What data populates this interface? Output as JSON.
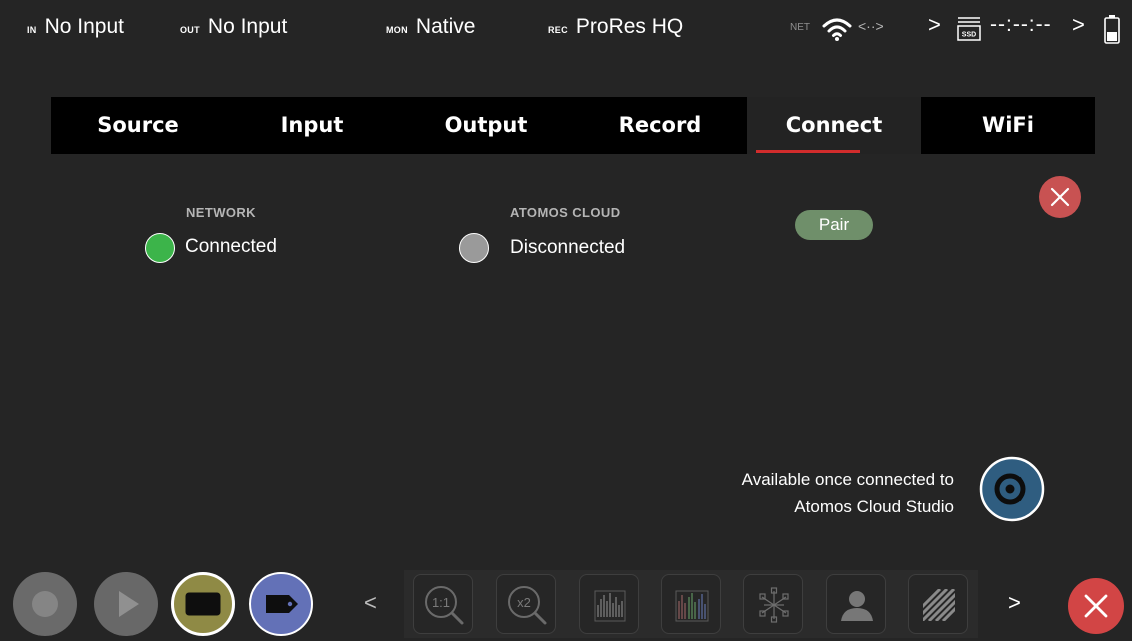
{
  "status_bar": {
    "input": {
      "tag": "IN",
      "value": "No Input"
    },
    "output": {
      "tag": "OUT",
      "value": "No Input"
    },
    "monitor": {
      "tag": "MON",
      "value": "Native"
    },
    "record": {
      "tag": "REC",
      "value": "ProRes HQ"
    },
    "network": {
      "tag": "NET",
      "wifi_icon": "wifi-icon",
      "link_icon": "network-arrows-icon",
      "link_glyph": "<··>"
    },
    "chevron_glyph": ">",
    "storage": {
      "icon": "ssd-icon",
      "label": "SSD",
      "timecode": "--:--:--"
    },
    "battery_icon": "battery-icon"
  },
  "tabs": [
    {
      "label": "Source",
      "active": false
    },
    {
      "label": "Input",
      "active": false
    },
    {
      "label": "Output",
      "active": false
    },
    {
      "label": "Record",
      "active": false
    },
    {
      "label": "Connect",
      "active": true
    },
    {
      "label": "WiFi",
      "active": false
    }
  ],
  "connect": {
    "network": {
      "title": "NETWORK",
      "status": "Connected",
      "status_color": "#3cb44a"
    },
    "cloud": {
      "title": "ATOMOS CLOUD",
      "status": "Disconnected",
      "status_color": "#9a9a9a"
    },
    "pair_button": "Pair",
    "close_icon": "close-icon",
    "cloud_message": {
      "line1": "Available once connected to",
      "line2": "Atomos Cloud Studio"
    },
    "cloud_studio_icon": "atomos-cloud-studio-icon"
  },
  "toolbar": {
    "buttons": [
      {
        "name": "record-button",
        "icon": "record-icon"
      },
      {
        "name": "play-button",
        "icon": "play-icon"
      },
      {
        "name": "monitor-mode-button",
        "icon": "monitor-icon"
      },
      {
        "name": "tag-button",
        "icon": "tag-icon"
      }
    ],
    "prev_glyph": "<",
    "next_glyph": ">",
    "tools": [
      {
        "name": "zoom-1-1-tool",
        "label": "1:1",
        "icon": "zoom-1-1-icon"
      },
      {
        "name": "zoom-x2-tool",
        "label": "x2",
        "icon": "zoom-x2-icon"
      },
      {
        "name": "waveform-tool",
        "icon": "waveform-icon"
      },
      {
        "name": "rgb-parade-tool",
        "icon": "rgb-parade-icon"
      },
      {
        "name": "vectorscope-tool",
        "icon": "vectorscope-icon"
      },
      {
        "name": "false-color-tool",
        "icon": "false-color-icon"
      },
      {
        "name": "zebra-tool",
        "icon": "zebra-icon"
      }
    ],
    "close_icon": "close-icon"
  },
  "colors": {
    "background": "#252525",
    "tab_bar": "#000000",
    "active_underline": "#d12c2c",
    "close_red": "#d24545",
    "pair_green": "#6f8f6a",
    "monitor_olive": "#8f8a45",
    "tag_blue": "#6371b7",
    "cloud_blue": "#2f5d80"
  }
}
